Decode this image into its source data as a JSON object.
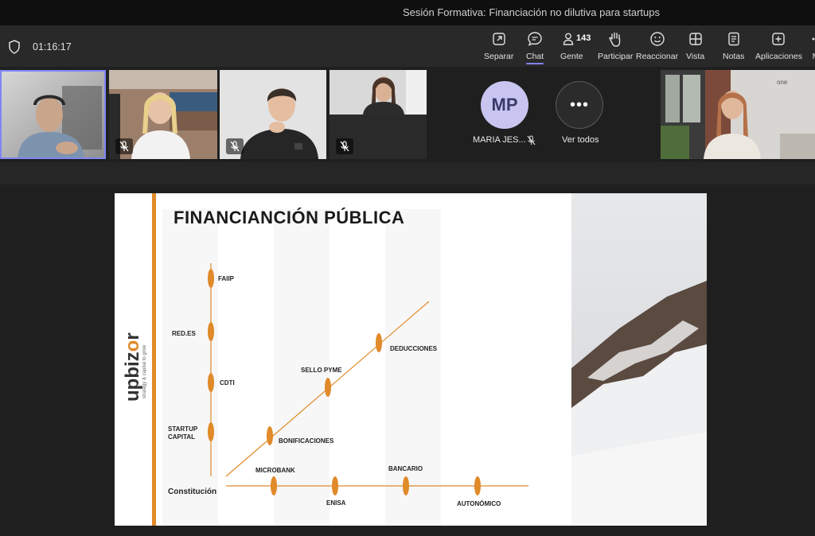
{
  "window": {
    "title": "Sesión Formativa: Financiación no dilutiva para startups"
  },
  "toolbar": {
    "timer": "01:16:17",
    "buttons": [
      {
        "label": "Separar",
        "icon": "pop-out-icon"
      },
      {
        "label": "Chat",
        "icon": "chat-icon"
      },
      {
        "label": "Gente",
        "icon": "people-icon",
        "count": "143"
      },
      {
        "label": "Participar",
        "icon": "raise-hand-icon"
      },
      {
        "label": "Reaccionar",
        "icon": "smiley-icon"
      },
      {
        "label": "Vista",
        "icon": "grid-icon"
      },
      {
        "label": "Notas",
        "icon": "notes-icon"
      },
      {
        "label": "Aplicaciones",
        "icon": "add-app-icon"
      },
      {
        "label": "M",
        "icon": "more-icon"
      }
    ],
    "active": "Chat"
  },
  "participants": {
    "mp_initials": "MP",
    "mp_name": "MARIA JES...",
    "see_all_label": "Ver todos",
    "see_all_glyph": "•••",
    "tile_logo": "one"
  },
  "slide": {
    "title": "FINANCIANCIÓN PÚBLICA",
    "brand": {
      "up": "up",
      "b": "b",
      "izor_i": "i",
      "izor_z": "z",
      "o": "o",
      "r": "r",
      "tagline": "strategy & capital to grow"
    },
    "labels": {
      "faiip": "FAIIP",
      "redes": "RED.ES",
      "cdti": "CDTI",
      "startup_1": "STARTUP",
      "startup_2": "CAPITAL",
      "sello": "SELLO PYME",
      "deducciones": "DEDUCCIONES",
      "bonificaciones": "BONIFICACIONES",
      "microbank": "MICROBANK",
      "bancario": "BANCARIO",
      "enisa": "ENISA",
      "autonomico": "AUTONÓMICO",
      "constitucion": "Constitución"
    },
    "accent": "#e08a2a"
  }
}
